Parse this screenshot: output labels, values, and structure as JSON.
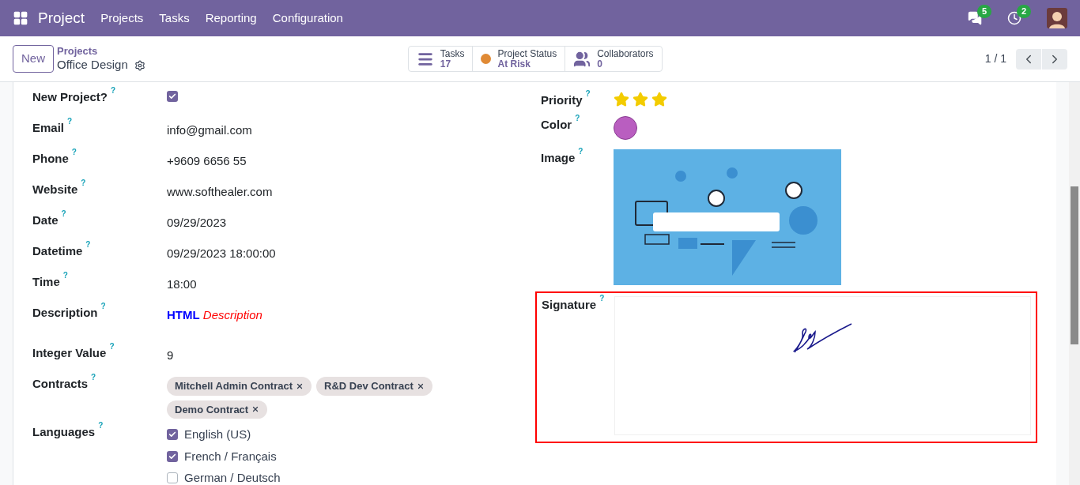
{
  "navbar": {
    "app_name": "Project",
    "menu": [
      "Projects",
      "Tasks",
      "Reporting",
      "Configuration"
    ],
    "messages_count": "5",
    "activities_count": "2"
  },
  "control_panel": {
    "new_button": "New",
    "breadcrumb": "Projects",
    "record_title": "Office Design",
    "pager": "1 / 1"
  },
  "smart_buttons": [
    {
      "kind": "tasks",
      "label": "Tasks",
      "value": "17"
    },
    {
      "kind": "status",
      "label": "Project Status",
      "value": "At Risk",
      "color": "#e08a35"
    },
    {
      "kind": "collaborators",
      "label": "Collaborators",
      "value": "0"
    }
  ],
  "left_fields": [
    {
      "kind": "checkbox",
      "label": "New Project?",
      "help": "?",
      "checked": true
    },
    {
      "kind": "text",
      "label": "Email",
      "help": "?",
      "value": "info@gmail.com"
    },
    {
      "kind": "text",
      "label": "Phone",
      "help": "?",
      "value": "+9609 6656 55"
    },
    {
      "kind": "text",
      "label": "Website",
      "help": "?",
      "value": "www.softhealer.com"
    },
    {
      "kind": "text",
      "label": "Date",
      "help": "?",
      "value": "09/29/2023"
    },
    {
      "kind": "text",
      "label": "Datetime",
      "help": "?",
      "value": "09/29/2023 18:00:00"
    },
    {
      "kind": "text",
      "label": "Time",
      "help": "?",
      "value": "18:00"
    },
    {
      "kind": "html",
      "label": "Description",
      "help": "?",
      "value": "**HTML** *Description*"
    },
    {
      "kind": "text",
      "label": "Integer Value",
      "help": "?",
      "value": "9"
    },
    {
      "kind": "tags",
      "label": "Contracts",
      "help": "?",
      "tags": [
        "Mitchell Admin Contract",
        "R&D Dev Contract",
        "Demo Contract"
      ]
    },
    {
      "kind": "checklist",
      "label": "Languages",
      "help": "?",
      "options": [
        {
          "label": "English (US)",
          "checked": true
        },
        {
          "label": "French / Français",
          "checked": true
        },
        {
          "label": "German / Deutsch",
          "checked": false
        }
      ]
    }
  ],
  "right_fields": [
    {
      "kind": "stars",
      "label": "Priority",
      "help": "?",
      "stars": 3
    },
    {
      "kind": "color",
      "label": "Color",
      "help": "?",
      "color": "#b95ec0"
    },
    {
      "label": "Image",
      "help": "?"
    },
    {
      "kind": "signature",
      "label": "Signature",
      "help": "?",
      "highlighted": true
    }
  ]
}
